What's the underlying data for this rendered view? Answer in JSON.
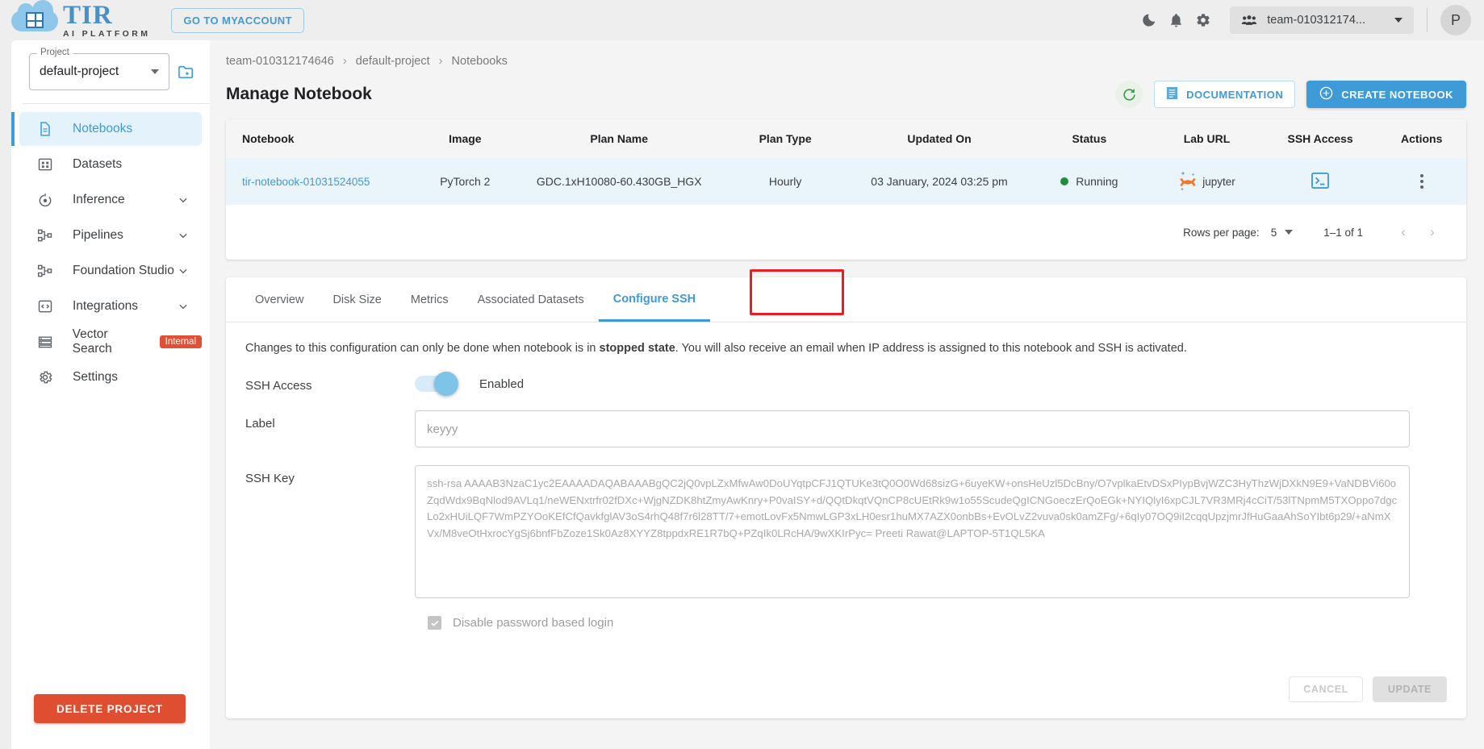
{
  "brand": {
    "name": "TIR",
    "tagline": "AI PLATFORM",
    "myaccount_label": "GO TO MYACCOUNT"
  },
  "topbar": {
    "icons": [
      "dark-mode-icon",
      "notifications-icon",
      "settings-icon"
    ],
    "team_label": "team-010312174...",
    "avatar_initial": "P"
  },
  "sidebar": {
    "project": {
      "legend": "Project",
      "value": "default-project"
    },
    "items": [
      {
        "label": "Notebooks",
        "icon": "document-icon",
        "active": true,
        "chevron": false
      },
      {
        "label": "Datasets",
        "icon": "grid-icon",
        "active": false,
        "chevron": false
      },
      {
        "label": "Inference",
        "icon": "inference-icon",
        "active": false,
        "chevron": true
      },
      {
        "label": "Pipelines",
        "icon": "pipeline-icon",
        "active": false,
        "chevron": true
      },
      {
        "label": "Foundation Studio",
        "icon": "pipeline-icon",
        "active": false,
        "chevron": true
      },
      {
        "label": "Integrations",
        "icon": "code-icon",
        "active": false,
        "chevron": true
      },
      {
        "label": "Vector Search",
        "icon": "list-icon",
        "active": false,
        "chevron": false,
        "badge": "Internal"
      },
      {
        "label": "Settings",
        "icon": "gear-icon",
        "active": false,
        "chevron": false
      }
    ],
    "delete_project_label": "DELETE PROJECT"
  },
  "breadcrumb": [
    "team-010312174646",
    "default-project",
    "Notebooks"
  ],
  "page": {
    "title": "Manage Notebook",
    "documentation_label": "DOCUMENTATION",
    "create_label": "CREATE NOTEBOOK"
  },
  "table": {
    "columns": [
      "Notebook",
      "Image",
      "Plan Name",
      "Plan Type",
      "Updated On",
      "Status",
      "Lab URL",
      "SSH Access",
      "Actions"
    ],
    "rows": [
      {
        "notebook": "tir-notebook-01031524055",
        "image": "PyTorch 2",
        "plan_name": "GDC.1xH10080-60.430GB_HGX",
        "plan_type": "Hourly",
        "updated_on": "03 January, 2024 03:25 pm",
        "status": "Running",
        "lab_url": "jupyter",
        "ssh_access": "terminal-icon",
        "actions": "kebab-menu-icon"
      }
    ],
    "pagination": {
      "rows_per_page_label": "Rows per page:",
      "rows_per_page_value": "5",
      "range": "1–1 of 1"
    }
  },
  "tabs": [
    {
      "label": "Overview",
      "active": false
    },
    {
      "label": "Disk Size",
      "active": false
    },
    {
      "label": "Metrics",
      "active": false
    },
    {
      "label": "Associated Datasets",
      "active": false
    },
    {
      "label": "Configure SSH",
      "active": true,
      "highlighted": true
    }
  ],
  "ssh_panel": {
    "info_pre": "Changes to this configuration can only be done when notebook is in ",
    "info_bold": "stopped state",
    "info_post": ". You will also receive an email when IP address is assigned to this notebook and SSH is activated.",
    "ssh_access_label": "SSH Access",
    "toggle_state": "Enabled",
    "label_label": "Label",
    "label_placeholder": "keyyy",
    "ssh_key_label": "SSH Key",
    "ssh_key_placeholder": "ssh-rsa AAAAB3NzaC1yc2EAAAADAQABAAABgQC2jQ0vpLZxMfwAw0DoUYqtpCFJ1QTUKe3tQ0O0Wd68sizG+6uyeKW+onsHeUzl5DcBny/O7vplkaEtvDSxPIypBvjWZC3HyThzWjDXkN9E9+VaNDBVi60oZqdWdx9BqNlod9AVLq1/neWENxtrfr02fDXc+WjgNZDK8htZmyAwKnry+P0vaISY+d/QQtDkqtVQnCP8cUEtRk9w1o55ScudeQgICNGoeczErQoEGk+NYIQlyI6xpCJL7VR3MRj4cCiT/53lTNpmM5TXOppo7dgcLo2xHUiLQF7WmPZYOoKEfCfQavkfglAV3oS4rhQ48f7r6l28TT/7+emotLovFx5NmwLGP3xLH0esr1huMX7AZX0onbBs+EvOLvZ2vuva0sk0amZFg/+6qIy07OQ9iI2cqqUpzjmrJfHuGaaAhSoYIbt6p29/+aNmXVx/M8veOtHxrocYgSj6bnfFbZoze1Sk0Az8XYYZ8tppdxRE1R7bQ+PZqIk0LRcHA/9wXKIrPyc= Preeti Rawat@LAPTOP-5T1QL5KA",
    "checkbox_label": "Disable password based login",
    "checkbox_checked": true,
    "cancel_label": "CANCEL",
    "update_label": "UPDATE"
  },
  "colors": {
    "accent": "#3f9ad8",
    "danger": "#e04e31",
    "success": "#1e8e3e",
    "highlight_box": "#ec1c24",
    "badge": "#e14f35"
  }
}
